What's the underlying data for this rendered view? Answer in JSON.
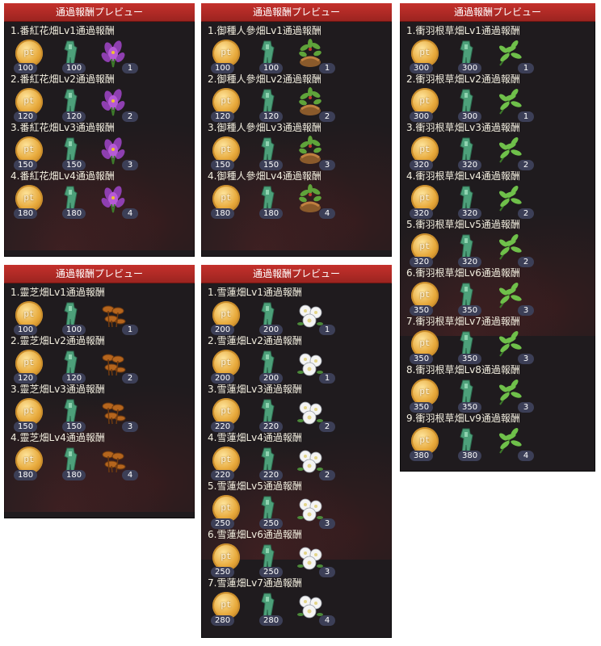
{
  "colors": {
    "header": "#b42b27",
    "panel": "#1f1b1e",
    "badge": "#3c3f57",
    "title_text": "#f2eedf"
  },
  "panels": [
    {
      "id": "saffron",
      "title": "通過報酬プレビュー",
      "plant_icon": "saffron-flower-icon",
      "rows": [
        {
          "label": "1.番紅花畑Lv1通過報酬",
          "pt": "100",
          "ticket": "100",
          "plant": "1"
        },
        {
          "label": "2.番紅花畑Lv2通過報酬",
          "pt": "120",
          "ticket": "120",
          "plant": "2"
        },
        {
          "label": "3.番紅花畑Lv3通過報酬",
          "pt": "150",
          "ticket": "150",
          "plant": "3"
        },
        {
          "label": "4.番紅花畑Lv4通過報酬",
          "pt": "180",
          "ticket": "180",
          "plant": "4"
        }
      ]
    },
    {
      "id": "ginseng",
      "title": "通過報酬プレビュー",
      "plant_icon": "ginseng-plant-icon",
      "rows": [
        {
          "label": "1.御種人參畑Lv1通過報酬",
          "pt": "100",
          "ticket": "100",
          "plant": "1"
        },
        {
          "label": "2.御種人參畑Lv2通過報酬",
          "pt": "120",
          "ticket": "120",
          "plant": "2"
        },
        {
          "label": "3.御種人參畑Lv3通過報酬",
          "pt": "150",
          "ticket": "150",
          "plant": "3"
        },
        {
          "label": "4.御種人參畑Lv4通過報酬",
          "pt": "180",
          "ticket": "180",
          "plant": "4"
        }
      ]
    },
    {
      "id": "herb",
      "title": "通過報酬プレビュー",
      "plant_icon": "herb-leaf-icon",
      "rows": [
        {
          "label": "1.衝羽根草畑Lv1通過報酬",
          "pt": "300",
          "ticket": "300",
          "plant": "1"
        },
        {
          "label": "2.衝羽根草畑Lv2通過報酬",
          "pt": "300",
          "ticket": "300",
          "plant": "1"
        },
        {
          "label": "3.衝羽根草畑Lv3通過報酬",
          "pt": "320",
          "ticket": "320",
          "plant": "2"
        },
        {
          "label": "4.衝羽根草畑Lv4通過報酬",
          "pt": "320",
          "ticket": "320",
          "plant": "2"
        },
        {
          "label": "5.衝羽根草畑Lv5通過報酬",
          "pt": "320",
          "ticket": "320",
          "plant": "2"
        },
        {
          "label": "6.衝羽根草畑Lv6通過報酬",
          "pt": "350",
          "ticket": "350",
          "plant": "3"
        },
        {
          "label": "7.衝羽根草畑Lv7通過報酬",
          "pt": "350",
          "ticket": "350",
          "plant": "3"
        },
        {
          "label": "8.衝羽根草畑Lv8通過報酬",
          "pt": "350",
          "ticket": "350",
          "plant": "3"
        },
        {
          "label": "9.衝羽根草畑Lv9通過報酬",
          "pt": "380",
          "ticket": "380",
          "plant": "4"
        }
      ]
    },
    {
      "id": "reishi",
      "title": "通過報酬プレビュー",
      "plant_icon": "reishi-mushroom-icon",
      "rows": [
        {
          "label": "1.靈芝畑Lv1通過報酬",
          "pt": "100",
          "ticket": "100",
          "plant": "1"
        },
        {
          "label": "2.靈芝畑Lv2通過報酬",
          "pt": "120",
          "ticket": "120",
          "plant": "2"
        },
        {
          "label": "3.靈芝畑Lv3通過報酬",
          "pt": "150",
          "ticket": "150",
          "plant": "3"
        },
        {
          "label": "4.靈芝畑Lv4通過報酬",
          "pt": "180",
          "ticket": "180",
          "plant": "4"
        }
      ]
    },
    {
      "id": "snowlotus",
      "title": "通過報酬プレビュー",
      "plant_icon": "snow-lotus-icon",
      "rows": [
        {
          "label": "1.雪蓮畑Lv1通過報酬",
          "pt": "200",
          "ticket": "200",
          "plant": "1"
        },
        {
          "label": "2.雪蓮畑Lv2通過報酬",
          "pt": "200",
          "ticket": "200",
          "plant": "1"
        },
        {
          "label": "3.雪蓮畑Lv3通過報酬",
          "pt": "220",
          "ticket": "220",
          "plant": "2"
        },
        {
          "label": "4.雪蓮畑Lv4通過報酬",
          "pt": "220",
          "ticket": "220",
          "plant": "2"
        },
        {
          "label": "5.雪蓮畑Lv5通過報酬",
          "pt": "250",
          "ticket": "250",
          "plant": "3"
        },
        {
          "label": "6.雪蓮畑Lv6通過報酬",
          "pt": "250",
          "ticket": "250",
          "plant": "3"
        },
        {
          "label": "7.雪蓮畑Lv7通過報酬",
          "pt": "280",
          "ticket": "280",
          "plant": "4"
        }
      ]
    }
  ],
  "coin_label": "pt"
}
